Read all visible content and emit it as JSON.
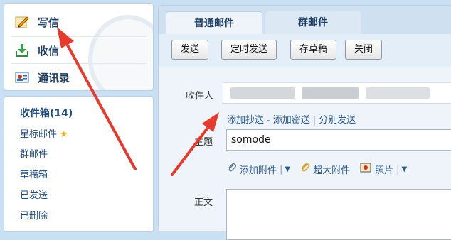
{
  "nav": {
    "write": "写信",
    "receive": "收信",
    "contacts": "通讯录"
  },
  "folders": {
    "inbox": "收件箱(14)",
    "starred": "星标邮件",
    "group": "群邮件",
    "drafts": "草稿箱",
    "sent": "已发送",
    "deleted": "已删除"
  },
  "tabs": {
    "normal": "普通邮件",
    "group": "群邮件"
  },
  "toolbar": {
    "send": "发送",
    "scheduled": "定时发送",
    "save_draft": "存草稿",
    "close": "关闭"
  },
  "form": {
    "recipient_label": "收件人",
    "add_cc": "添加抄送",
    "add_bcc": "添加密送",
    "separate_send": "分别发送",
    "link_sep": "-",
    "link_sep2": "|",
    "subject_label": "主题",
    "subject_value": "somode",
    "add_attachment": "添加附件",
    "large_attachment": "超大附件",
    "photo": "照片",
    "body_label": "正文"
  },
  "icons": {
    "write": "pencil-icon",
    "receive": "inbox-download-icon",
    "contacts": "contact-card-icon",
    "star": "star-icon",
    "attachment": "paperclip-icon",
    "photo": "photo-icon"
  },
  "colors": {
    "annotation_arrow": "#e53a2e",
    "link": "#2a5a8c",
    "nav_text": "#1f3f63"
  }
}
